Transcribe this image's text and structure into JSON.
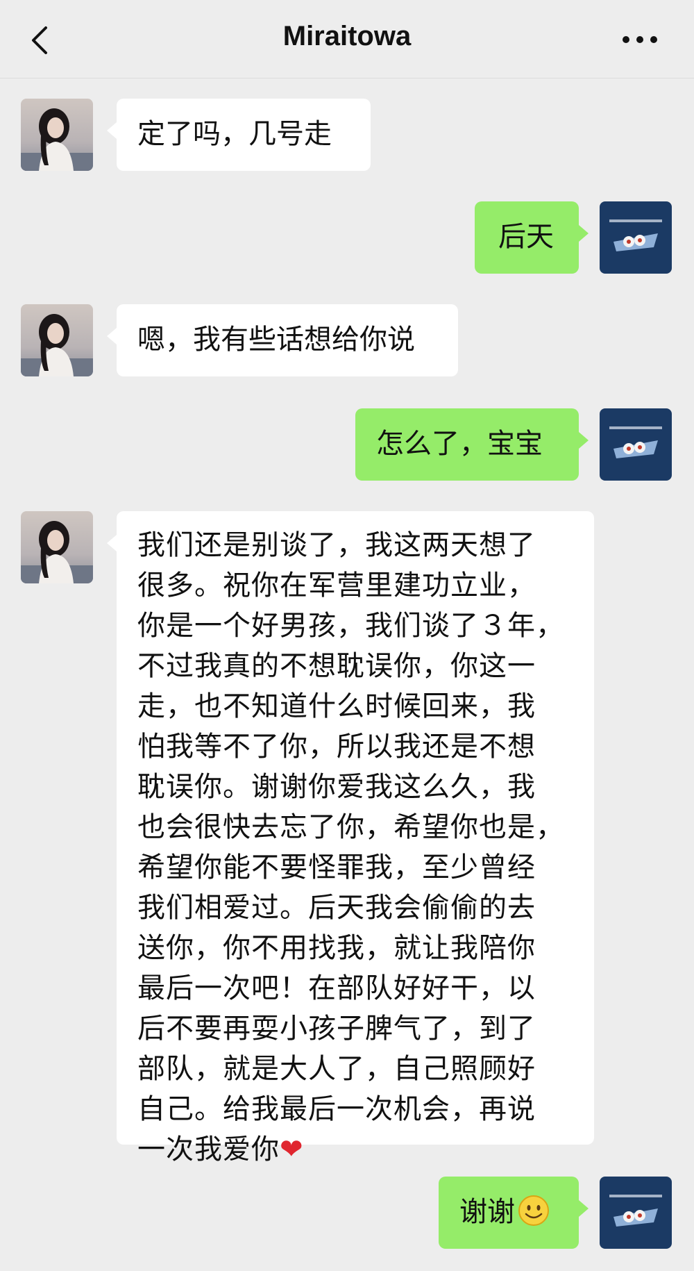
{
  "header": {
    "title": "Miraitowa"
  },
  "messages": [
    {
      "sender": "contact",
      "text": "定了吗，几号走"
    },
    {
      "sender": "me",
      "text": "后天"
    },
    {
      "sender": "contact",
      "text": "嗯，我有些话想给你说"
    },
    {
      "sender": "me",
      "text": "怎么了，宝宝"
    },
    {
      "sender": "contact",
      "text": "我们还是别谈了，我这两天想了\n很多。祝你在军营里建功立业，\n你是一个好男孩，我们谈了３年，\n不过我真的不想耽误你，你这一\n走，也不知道什么时候回来，我\n怕我等不了你，所以我还是不想\n耽误你。谢谢你爱我这么久，我\n也会很快去忘了你，希望你也是，\n希望你能不要怪罪我，至少曾经\n我们相爱过。后天我会偷偷的去\n送你，你不用找我，就让我陪你\n最后一次吧！在部队好好干，以\n后不要再耍小孩子脾气了，到了\n部队，就是大人了，自己照顾好\n自己。给我最后一次机会，再说\n一次我爱你",
      "emoji": "heart"
    },
    {
      "sender": "me",
      "text": "谢谢",
      "emoji": "smile"
    }
  ],
  "colors": {
    "background": "#ededed",
    "received_bubble": "#ffffff",
    "sent_bubble": "#95ec69",
    "my_avatar": "#1b3a64"
  },
  "icons": {
    "back": "chevron-left-icon",
    "more": "more-dots-icon",
    "heart": "red-heart-emoji",
    "smile": "smiling-face-emoji"
  }
}
